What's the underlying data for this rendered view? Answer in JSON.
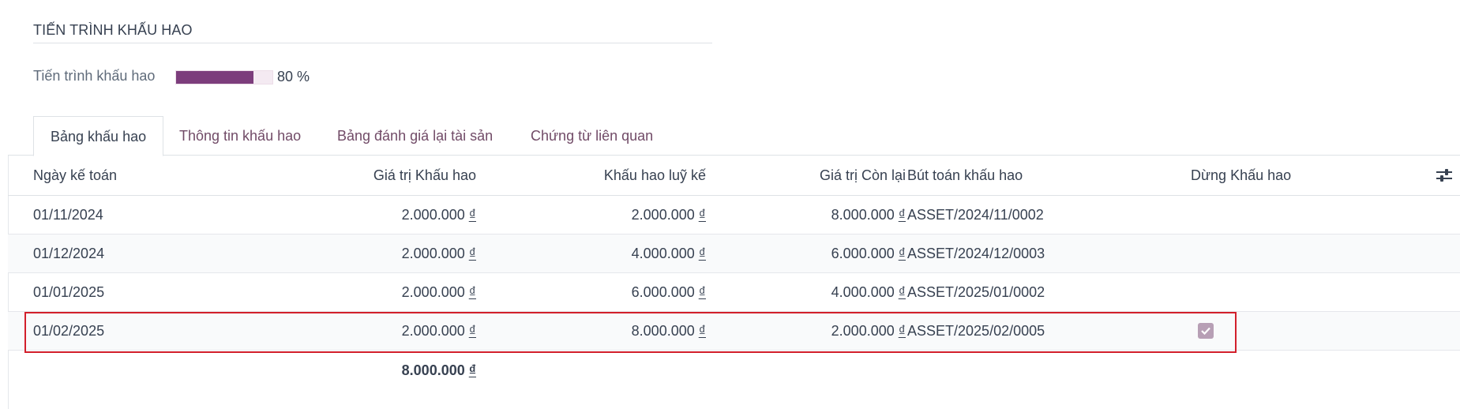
{
  "section": {
    "title": "TIẾN TRÌNH KHẤU HAO"
  },
  "progress": {
    "label": "Tiến trình khấu hao",
    "value_text": "80 %",
    "fraction": 0.8
  },
  "tabs": [
    {
      "label": "Bảng khấu hao",
      "active": true
    },
    {
      "label": "Thông tin khấu hao",
      "active": false
    },
    {
      "label": "Bảng đánh giá lại tài sản",
      "active": false
    },
    {
      "label": "Chứng từ liên quan",
      "active": false
    }
  ],
  "table": {
    "columns": {
      "date": "Ngày kế toán",
      "depreciation_value": "Giá trị Khấu hao",
      "accumulated": "Khấu hao luỹ kế",
      "remaining": "Giá trị Còn lại",
      "move": "Bút toán khấu hao",
      "stop": "Dừng Khấu hao"
    },
    "currency_symbol": "₫",
    "rows": [
      {
        "date": "01/11/2024",
        "depreciation_value": "2.000.000",
        "accumulated": "2.000.000",
        "remaining": "8.000.000",
        "move": "ASSET/2024/11/0002",
        "stop": false
      },
      {
        "date": "01/12/2024",
        "depreciation_value": "2.000.000",
        "accumulated": "4.000.000",
        "remaining": "6.000.000",
        "move": "ASSET/2024/12/0003",
        "stop": false
      },
      {
        "date": "01/01/2025",
        "depreciation_value": "2.000.000",
        "accumulated": "6.000.000",
        "remaining": "4.000.000",
        "move": "ASSET/2025/01/0002",
        "stop": false
      },
      {
        "date": "01/02/2025",
        "depreciation_value": "2.000.000",
        "accumulated": "8.000.000",
        "remaining": "2.000.000",
        "move": "ASSET/2025/02/0005",
        "stop": true
      }
    ],
    "total": {
      "depreciation_value": "8.000.000"
    }
  },
  "colors": {
    "accent": "#714b67",
    "progress_fill": "#7c3d7c",
    "highlight_border": "#d21f2b",
    "checkbox": "#b79fb5"
  },
  "icons": {
    "optional_columns": "sliders-icon",
    "checked": "check-icon"
  }
}
